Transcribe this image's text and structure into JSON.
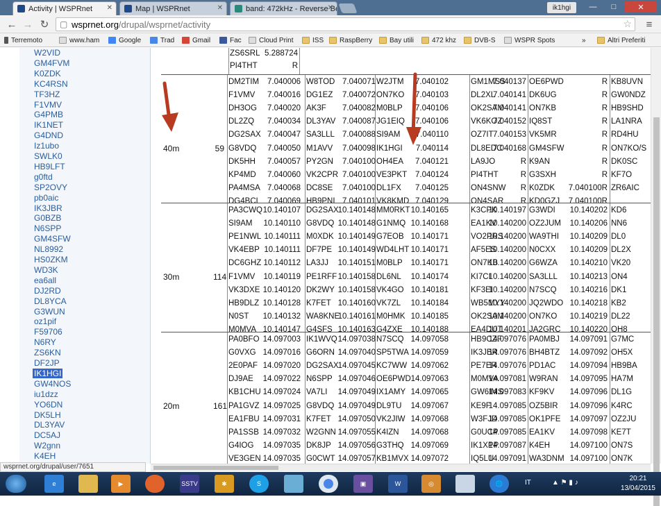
{
  "tabs": [
    {
      "title": "Activity | WSPRnet",
      "color": "#1e4a8c",
      "active": true
    },
    {
      "title": "Map | WSPRnet",
      "color": "#1e4a8c",
      "active": false
    },
    {
      "title": "band: 472kHz - Reverse Be",
      "color": "#2a8a7a",
      "active": false
    }
  ],
  "window": {
    "user_tag": "ik1hgi",
    "minimize": "—",
    "maximize": "□",
    "close": "✕"
  },
  "address": {
    "host": "wsprnet.org",
    "path": "/drupal/wsprnet/activity"
  },
  "bookmarks": [
    {
      "label": "Terremoto",
      "icon": "pin-icon"
    },
    {
      "label": "www.ham",
      "icon": "page-icon"
    },
    {
      "label": "Google",
      "icon": "google-icon"
    },
    {
      "label": "Trad",
      "icon": "translate-icon"
    },
    {
      "label": "Gmail",
      "icon": "gmail-icon"
    },
    {
      "label": "Fac",
      "icon": "facebook-icon"
    },
    {
      "label": "Cloud Print",
      "icon": "page-icon"
    },
    {
      "label": "ISS",
      "icon": "folder-icon"
    },
    {
      "label": "RaspBerry",
      "icon": "folder-icon"
    },
    {
      "label": "Bay utili",
      "icon": "folder-icon"
    },
    {
      "label": "472 khz",
      "icon": "folder-icon"
    },
    {
      "label": "DVB-S",
      "icon": "folder-icon"
    },
    {
      "label": "WSPR Spots",
      "icon": "page-icon"
    },
    {
      "label": "»",
      "icon": ""
    },
    {
      "label": "Altri Preferiti",
      "icon": "folder-icon"
    }
  ],
  "sidebar": {
    "links": [
      "W2VID",
      "GM4FVM",
      "K0ZDK",
      "KC4RSN",
      "TF3HZ",
      "F1VMV",
      "G4PMB",
      "IK1NET",
      "G4DND",
      "Iz1ubo",
      "SWLK0",
      "HB9LFT",
      "g0ftd",
      "SP2OVY",
      "pb0aic",
      "IK3JBR",
      "G0BZB",
      "N6SPP",
      "GM4SFW",
      "NL8992",
      "HS0ZKM",
      "WD3K",
      "ea6all",
      "DJ2RD",
      "DL8YCA",
      "G3WUN",
      "oz1pif",
      "F59706",
      "N6RY",
      "ZS6KN",
      "DF2JP",
      "IK1HGI",
      "GW4NOS",
      "iu1dzz",
      "YO6DN",
      "DK5LH",
      "DL3YAV",
      "DC5AJ",
      "W2gnn",
      "K4EH"
    ],
    "selected": "IK1HGI"
  },
  "status_url": "wsprnet.org/drupal/user/7651",
  "top_fragment": [
    [
      "ZS6SRL",
      "5.288724"
    ],
    [
      "PI4THT",
      "R"
    ]
  ],
  "bands": [
    {
      "name": "40m",
      "count": "59",
      "columns": [
        [
          [
            "DM2TIM",
            "7.040006"
          ],
          [
            "F1VMV",
            "7.040016"
          ],
          [
            "DH3OG",
            "7.040020"
          ],
          [
            "DL2ZQ",
            "7.040034"
          ],
          [
            "DG2SAX",
            "7.040047"
          ],
          [
            "G8VDQ",
            "7.040050"
          ],
          [
            "DK5HH",
            "7.040057"
          ],
          [
            "KP4MD",
            "7.040060"
          ],
          [
            "PA4MSA",
            "7.040068"
          ],
          [
            "DG4BCL",
            "7.040069"
          ]
        ],
        [
          [
            "W8TOD",
            "7.040071"
          ],
          [
            "DG1EZ",
            "7.040072"
          ],
          [
            "AK3F",
            "7.040082"
          ],
          [
            "DL3YAV",
            "7.040087"
          ],
          [
            "SA3LLL",
            "7.040088"
          ],
          [
            "M1AVV",
            "7.040098"
          ],
          [
            "PY2GN",
            "7.040100"
          ],
          [
            "VK2CPR",
            "7.040100"
          ],
          [
            "DC8SE",
            "7.040100"
          ],
          [
            "HB9PNI",
            "7.040101"
          ]
        ],
        [
          [
            "W2JTM",
            "7.040102"
          ],
          [
            "ON7KO",
            "7.040103"
          ],
          [
            "M0BLP",
            "7.040106"
          ],
          [
            "JG1EIQ",
            "7.040106"
          ],
          [
            "SI9AM",
            "7.040110"
          ],
          [
            "IK1HGI",
            "7.040114"
          ],
          [
            "OH4EA",
            "7.040121"
          ],
          [
            "VE3PKT",
            "7.040124"
          ],
          [
            "DL1FX",
            "7.040125"
          ],
          [
            "VK8KMD",
            "7.040129"
          ]
        ],
        [
          [
            "GM1MSS",
            "7.040137"
          ],
          [
            "DL2XL",
            "7.040141"
          ],
          [
            "OK2SAM",
            "7.040141"
          ],
          [
            "VK6KOZ",
            "7.040152"
          ],
          [
            "OZ7IT",
            "7.040153"
          ],
          [
            "DL8EDC",
            "7.040168"
          ],
          [
            "LA9JO",
            "R"
          ],
          [
            "PI4THT",
            "R"
          ],
          [
            "ON4SNW",
            "R"
          ],
          [
            "ON4SAR",
            "R"
          ]
        ],
        [
          [
            "OE6PWD",
            "R"
          ],
          [
            "DK6UG",
            "R"
          ],
          [
            "ON7KB",
            "R"
          ],
          [
            "IQ8ST",
            "R"
          ],
          [
            "VK5MR",
            "R"
          ],
          [
            "GM4SFW",
            "R"
          ],
          [
            "K9AN",
            "R"
          ],
          [
            "G3SXH",
            "R"
          ],
          [
            "K0ZDK",
            "7.040100R"
          ],
          [
            "KD0GZJ",
            "7.040100R"
          ]
        ],
        [
          [
            "KB8UVN",
            ""
          ],
          [
            "GW0NDZ",
            ""
          ],
          [
            "HB9SHD",
            ""
          ],
          [
            "LA1NRA",
            ""
          ],
          [
            "RD4HU",
            ""
          ],
          [
            "ON7KO/S",
            ""
          ],
          [
            "DK0SC",
            ""
          ],
          [
            "KF7O",
            ""
          ],
          [
            "ZR6AIC",
            ""
          ]
        ]
      ]
    },
    {
      "name": "30m",
      "count": "114",
      "columns": [
        [
          [
            "PA3CWQ",
            "10.140107"
          ],
          [
            "SI9AM",
            "10.140110"
          ],
          [
            "PE1NWL",
            "10.140111"
          ],
          [
            "VK4EBP",
            "10.140111"
          ],
          [
            "DC6GHZ",
            "10.140112"
          ],
          [
            "F1VMV",
            "10.140119"
          ],
          [
            "VK3DXE",
            "10.140120"
          ],
          [
            "HB9DLZ",
            "10.140128"
          ],
          [
            "N0ST",
            "10.140132"
          ],
          [
            "M0MVA",
            "10.140147"
          ]
        ],
        [
          [
            "DG2SAX",
            "10.140148"
          ],
          [
            "G8VDQ",
            "10.140148"
          ],
          [
            "M0XDK",
            "10.140149"
          ],
          [
            "DF7PE",
            "10.140149"
          ],
          [
            "LA3JJ",
            "10.140151"
          ],
          [
            "PE1RFF",
            "10.140158"
          ],
          [
            "DK2WY",
            "10.140158"
          ],
          [
            "K7FET",
            "10.140160"
          ],
          [
            "WA8KNE",
            "10.140161"
          ],
          [
            "G4SFS",
            "10.140163"
          ]
        ],
        [
          [
            "MM0RKT",
            "10.140165"
          ],
          [
            "G1NMQ",
            "10.140168"
          ],
          [
            "G7EOB",
            "10.140171"
          ],
          [
            "WD4LHT",
            "10.140171"
          ],
          [
            "M0BLP",
            "10.140171"
          ],
          [
            "DL6NL",
            "10.140174"
          ],
          [
            "VK4GO",
            "10.140181"
          ],
          [
            "VK7ZL",
            "10.140184"
          ],
          [
            "M0HMK",
            "10.140185"
          ],
          [
            "G4ZXE",
            "10.140188"
          ]
        ],
        [
          [
            "K3CPK",
            "10.140197"
          ],
          [
            "EA1KV",
            "10.140200"
          ],
          [
            "VO2PRS",
            "10.140200"
          ],
          [
            "AF5ES",
            "10.140200"
          ],
          [
            "ON7KB",
            "10.140200"
          ],
          [
            "KI7CI",
            "10.140200"
          ],
          [
            "KF3EI",
            "10.140200"
          ],
          [
            "WB5MYY",
            "10.140200"
          ],
          [
            "OK2SAM",
            "10.140200"
          ],
          [
            "EA4DUT",
            "10.140201"
          ]
        ],
        [
          [
            "G3WDI",
            "10.140202"
          ],
          [
            "OZ2JUM",
            "10.140206"
          ],
          [
            "WA9THI",
            "10.140209"
          ],
          [
            "N0CXX",
            "10.140209"
          ],
          [
            "G6WZA",
            "10.140210"
          ],
          [
            "SA3LLL",
            "10.140213"
          ],
          [
            "N7SCQ",
            "10.140216"
          ],
          [
            "JQ2WDO",
            "10.140218"
          ],
          [
            "ON7KO",
            "10.140219"
          ],
          [
            "JA2GRC",
            "10.140220"
          ]
        ],
        [
          [
            "KD6",
            ""
          ],
          [
            "NN6",
            ""
          ],
          [
            "DL0",
            ""
          ],
          [
            "DL2X",
            ""
          ],
          [
            "VK20",
            ""
          ],
          [
            "ON4",
            ""
          ],
          [
            "DK1",
            ""
          ],
          [
            "KB2",
            ""
          ],
          [
            "DL22",
            ""
          ],
          [
            "OH8",
            ""
          ]
        ]
      ]
    },
    {
      "name": "20m",
      "count": "161",
      "columns": [
        [
          [
            "PA0BFO",
            "14.097003"
          ],
          [
            "G0VXG",
            "14.097016"
          ],
          [
            "2E0PAF",
            "14.097020"
          ],
          [
            "DJ9AE",
            "14.097022"
          ],
          [
            "KB1CHU",
            "14.097024"
          ],
          [
            "PA1GVZ",
            "14.097025"
          ],
          [
            "EA1FBU",
            "14.097031"
          ],
          [
            "PA1SSB",
            "14.097032"
          ],
          [
            "G4IOG",
            "14.097035"
          ],
          [
            "VE3GEN",
            "14.097035"
          ]
        ],
        [
          [
            "IK1WVQ",
            "14.097038"
          ],
          [
            "G6ORN",
            "14.097040"
          ],
          [
            "DG2SAX",
            "14.097045"
          ],
          [
            "N6SPP",
            "14.097046"
          ],
          [
            "VA7LI",
            "14.097049"
          ],
          [
            "G8VDQ",
            "14.097049"
          ],
          [
            "K7FET",
            "14.097050"
          ],
          [
            "W2GNN",
            "14.097055"
          ],
          [
            "DK8JP",
            "14.097056"
          ],
          [
            "G0CWT",
            "14.097057"
          ]
        ],
        [
          [
            "N7SCQ",
            "14.097058"
          ],
          [
            "SP5TWA",
            "14.097059"
          ],
          [
            "KC7WW",
            "14.097062"
          ],
          [
            "OE6PWD",
            "14.097063"
          ],
          [
            "IX1AMY",
            "14.097065"
          ],
          [
            "DL9TU",
            "14.097067"
          ],
          [
            "VK2JIW",
            "14.097068"
          ],
          [
            "K4IZN",
            "14.097068"
          ],
          [
            "G3THQ",
            "14.097069"
          ],
          [
            "KB1MVX",
            "14.097072"
          ]
        ],
        [
          [
            "HB9CZF",
            "14.097076"
          ],
          [
            "IK3JBR",
            "14.097076"
          ],
          [
            "PE7ER",
            "14.097076"
          ],
          [
            "M0MVA",
            "14.097081"
          ],
          [
            "GW6IMS",
            "14.097083"
          ],
          [
            "KE9F",
            "14.097085"
          ],
          [
            "W3FJD",
            "14.097085"
          ],
          [
            "G0UCP",
            "14.097085"
          ],
          [
            "IK1XPP",
            "14.097087"
          ],
          [
            "IQ5LU",
            "14.097091"
          ]
        ],
        [
          [
            "PA0MBJ",
            "14.097091"
          ],
          [
            "BH4BTZ",
            "14.097092"
          ],
          [
            "PD1AC",
            "14.097094"
          ],
          [
            "W9RAN",
            "14.097095"
          ],
          [
            "KF9KV",
            "14.097096"
          ],
          [
            "OZ5BIR",
            "14.097096"
          ],
          [
            "OK1PFE",
            "14.097097"
          ],
          [
            "EA1KV",
            "14.097098"
          ],
          [
            "K4EH",
            "14.097100"
          ],
          [
            "WA3DNM",
            "14.097100"
          ]
        ],
        [
          [
            "G7MC",
            ""
          ],
          [
            "OH5X",
            ""
          ],
          [
            "HB9BA",
            ""
          ],
          [
            "HA7M",
            ""
          ],
          [
            "DL1G",
            ""
          ],
          [
            "K4RC",
            ""
          ],
          [
            "OZ2JU",
            ""
          ],
          [
            "KE7T",
            ""
          ],
          [
            "ON7S",
            ""
          ],
          [
            "ON7K",
            ""
          ]
        ]
      ]
    }
  ],
  "taskbar": {
    "lang": "IT",
    "time": "20:21",
    "date": "13/04/2015",
    "apps": [
      "start-orb",
      "ie",
      "explorer",
      "media-player",
      "firefox",
      "sstv",
      "spark",
      "skype",
      "notes",
      "chrome",
      "floppy",
      "word",
      "spiral",
      "wspr-app",
      "globe"
    ]
  }
}
